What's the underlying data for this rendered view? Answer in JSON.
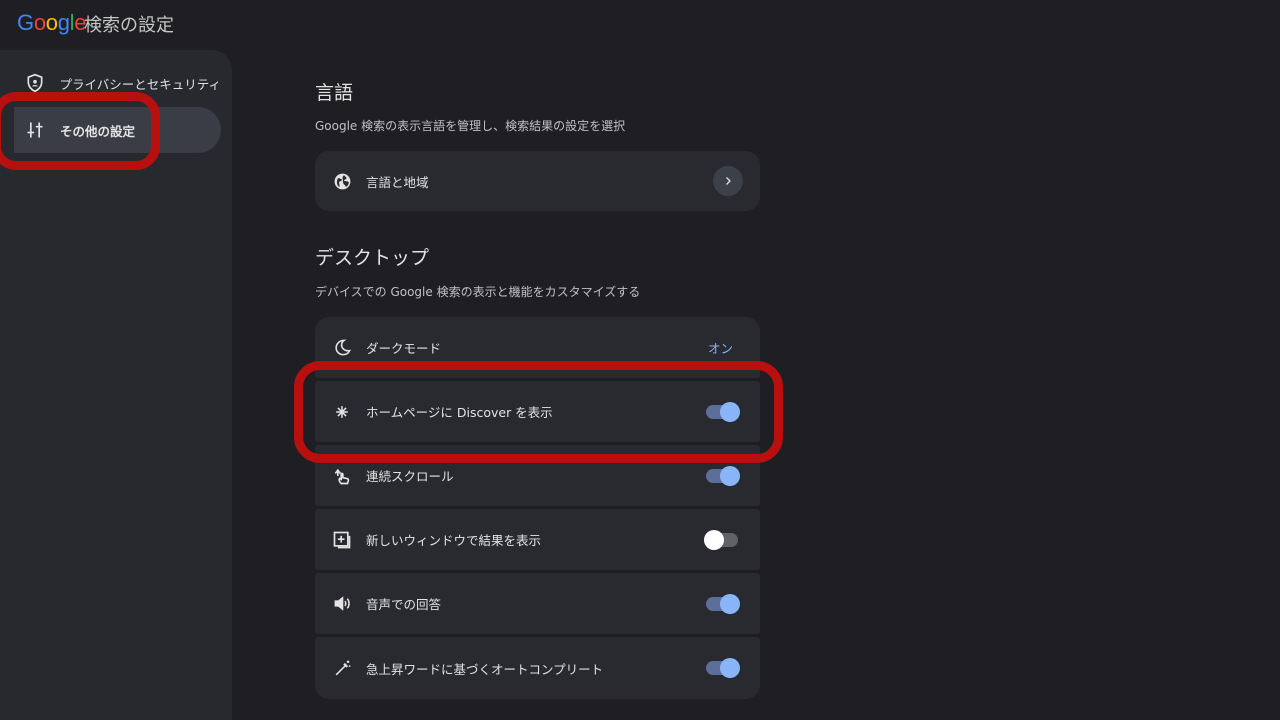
{
  "header": {
    "logo": [
      "G",
      "o",
      "o",
      "g",
      "l",
      "e"
    ],
    "title": "検索の設定"
  },
  "sidebar": {
    "items": [
      {
        "label": "プライバシーとセキュリティ",
        "icon": "shield-icon",
        "active": false
      },
      {
        "label": "その他の設定",
        "icon": "sliders-icon",
        "active": true
      }
    ]
  },
  "language_section": {
    "title": "言語",
    "description": "Google 検索の表示言語を管理し、検索結果の設定を選択",
    "card_label": "言語と地域",
    "card_icon": "globe-icon"
  },
  "desktop_section": {
    "title": "デスクトップ",
    "description": "デバイスでの Google 検索の表示と機能をカスタマイズする",
    "items": [
      {
        "label": "ダークモード",
        "icon": "moon-icon",
        "status": "オン"
      },
      {
        "label": "ホームページに Discover を表示",
        "icon": "sparkle-icon",
        "toggle": true
      },
      {
        "label": "連続スクロール",
        "icon": "scroll-gesture-icon",
        "toggle": true
      },
      {
        "label": "新しいウィンドウで結果を表示",
        "icon": "add-box-icon",
        "toggle": false
      },
      {
        "label": "音声での回答",
        "icon": "volume-icon",
        "toggle": true
      },
      {
        "label": "急上昇ワードに基づくオートコンプリート",
        "icon": "magic-wand-icon",
        "toggle": true
      }
    ]
  },
  "colors": {
    "highlight": "#b80f0f",
    "accent": "#8ab4f8"
  }
}
